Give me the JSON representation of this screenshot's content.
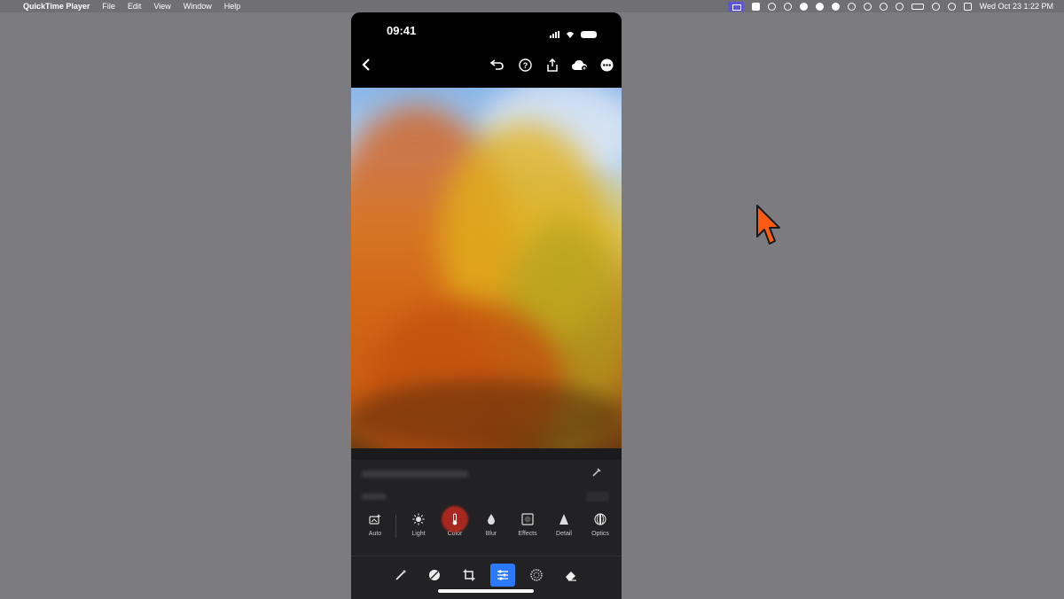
{
  "menubar": {
    "apple": "",
    "app_name": "QuickTime Player",
    "menus": [
      "File",
      "Edit",
      "View",
      "Window",
      "Help"
    ],
    "clock": "Wed Oct 23  1:22 PM"
  },
  "phone": {
    "time": "09:41",
    "toolbar_icons": [
      "back-chevron-icon",
      "undo-icon",
      "help-icon",
      "share-icon",
      "cloud-sync-icon",
      "more-icon"
    ],
    "tools": [
      {
        "label": "Auto",
        "icon": "auto-icon"
      },
      {
        "label": "Light",
        "icon": "sun-icon"
      },
      {
        "label": "Color",
        "icon": "thermometer-icon",
        "active": true
      },
      {
        "label": "Blur",
        "icon": "drop-icon"
      },
      {
        "label": "Effects",
        "icon": "effects-icon"
      },
      {
        "label": "Detail",
        "icon": "triangle-icon"
      },
      {
        "label": "Optics",
        "icon": "lens-icon"
      }
    ],
    "bottom_tools": [
      "magic-wand-icon",
      "healing-icon",
      "crop-icon",
      "adjust-sliders-icon",
      "masking-icon",
      "eraser-icon"
    ],
    "active_bottom_tool": "adjust-sliders-icon"
  },
  "colors": {
    "accent": "#2b79ff",
    "active_tool_highlight": "#c0291f",
    "cursor": "#ff5a12"
  }
}
